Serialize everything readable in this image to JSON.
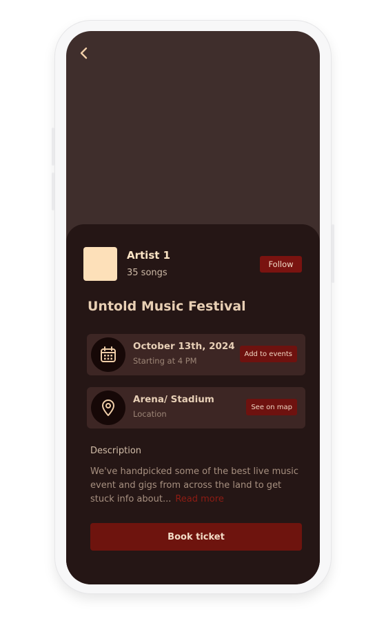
{
  "artist": {
    "name": "Artist 1",
    "songs": "35 songs",
    "follow_label": "Follow"
  },
  "event": {
    "title": "Untold Music Festival"
  },
  "date_card": {
    "title": "October 13th, 2024",
    "subtitle": "Starting at 4 PM",
    "button_label": "Add to events",
    "icon": "calendar-icon"
  },
  "location_card": {
    "title": "Arena/ Stadium",
    "subtitle": "Location",
    "button_label": "See on map",
    "icon": "location-pin-icon"
  },
  "description": {
    "label": "Description",
    "text": "We've handpicked some of the best live music event and gigs from across the land to get stuck info about...",
    "read_more": "Read more"
  },
  "book_label": "Book ticket",
  "colors": {
    "background_top": "#3f2e2c",
    "sheet": "#251615",
    "accent": "#6e140e",
    "artist_thumb": "#fde0b9"
  }
}
